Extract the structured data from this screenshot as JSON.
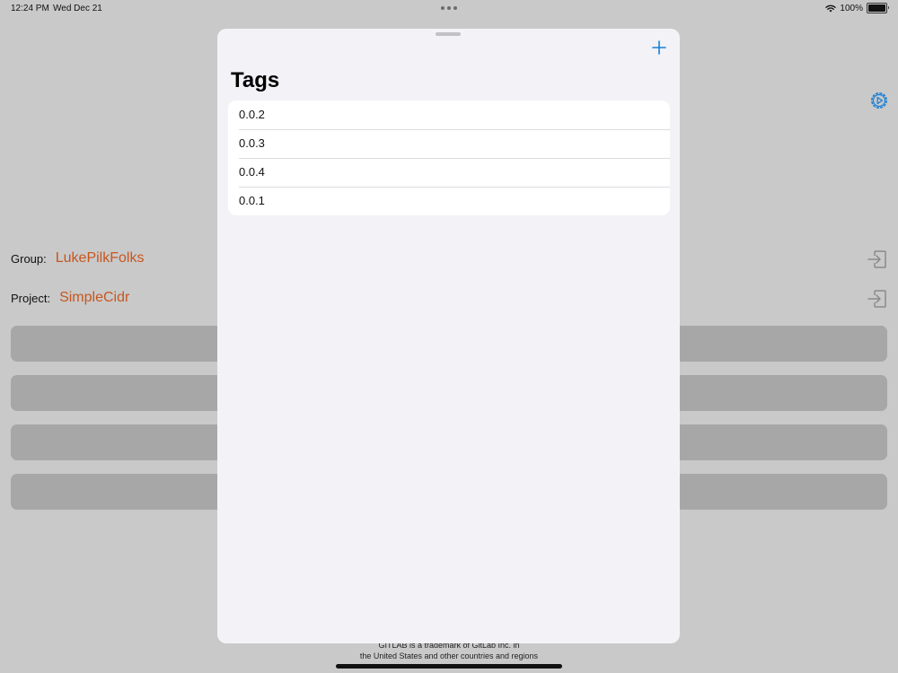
{
  "status_bar": {
    "time": "12:24 PM",
    "date": "Wed Dec 21",
    "battery": "100%"
  },
  "background": {
    "group_label": "Group:",
    "group_value": "LukePilkFolks",
    "project_label": "Project:",
    "project_value": "SimpleCidr",
    "footer_line1": "GITLAB is a trademark of GitLab Inc. in",
    "footer_line2": "the United States and other countries and regions",
    "accent_color": "#c8561f"
  },
  "sheet": {
    "title": "Tags",
    "tags": [
      {
        "label": "0.0.2"
      },
      {
        "label": "0.0.3"
      },
      {
        "label": "0.0.4"
      },
      {
        "label": "0.0.1"
      }
    ],
    "tint_color": "#1a7fd4"
  },
  "icons": {
    "add": "plus-icon",
    "settings": "gear-icon",
    "login": "login-arrow-icon",
    "wifi": "wifi-icon",
    "battery": "battery-icon"
  }
}
